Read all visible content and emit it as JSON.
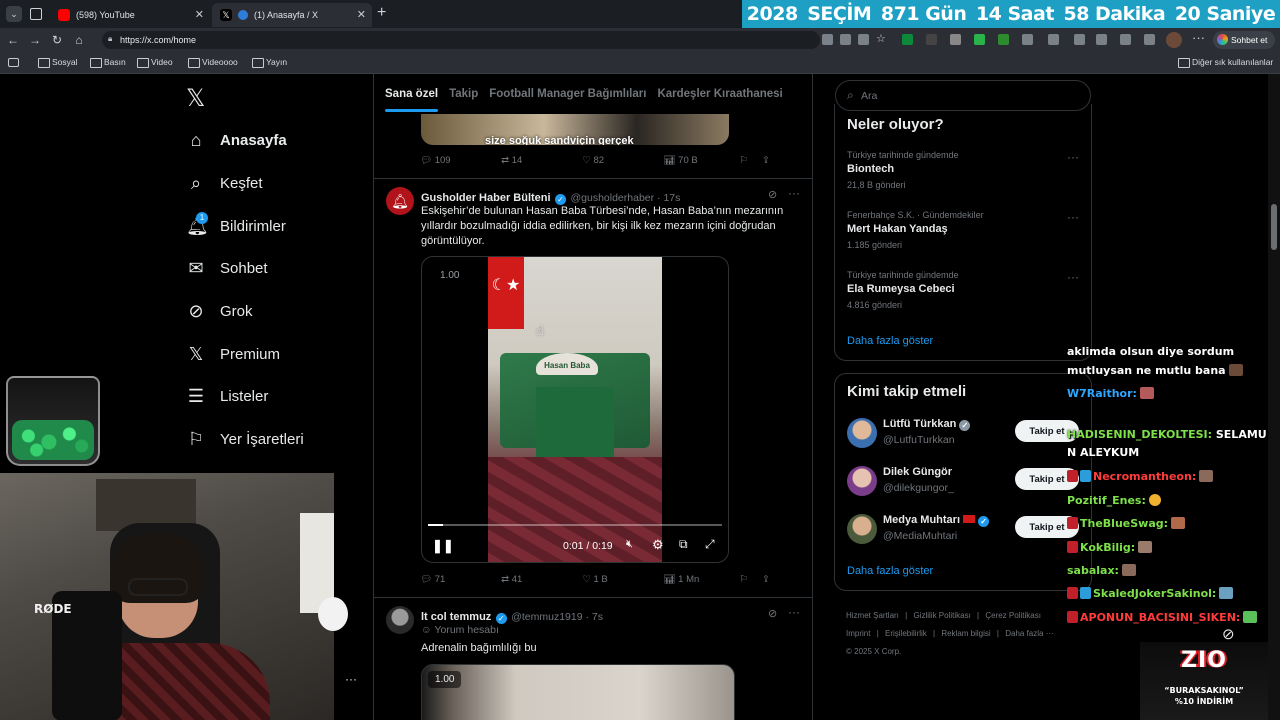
{
  "browser": {
    "tabs": [
      {
        "title": "(598) YouTube"
      },
      {
        "title": "(1) Anasayfa / X"
      }
    ],
    "url": "https://x.com/home",
    "chat_button": "Sohbet et",
    "bookmarks": [
      "Sosyal",
      "Basın",
      "Video",
      "Videoooo",
      "Yayın"
    ],
    "other_bookmarks": "Diğer sık kullanılanlar"
  },
  "countdown": {
    "year": "2028",
    "label": "SEÇİM",
    "days": "871 Gün",
    "hours": "14 Saat",
    "minutes": "58 Dakika",
    "seconds": "20 Saniye"
  },
  "sidebar": {
    "items": [
      {
        "label": "Anasayfa",
        "icon": "home-icon"
      },
      {
        "label": "Keşfet",
        "icon": "search-icon"
      },
      {
        "label": "Bildirimler",
        "icon": "bell-icon",
        "badge": "1"
      },
      {
        "label": "Sohbet",
        "icon": "mail-icon"
      },
      {
        "label": "Grok",
        "icon": "grok-icon"
      },
      {
        "label": "Premium",
        "icon": "x-icon"
      },
      {
        "label": "Listeler",
        "icon": "list-icon"
      },
      {
        "label": "Yer İşaretleri",
        "icon": "bookmark-icon"
      }
    ]
  },
  "feed": {
    "tabs": [
      "Sana özel",
      "Takip",
      "Football Manager Bağımlıları",
      "Kardeşler Kıraathanesi"
    ],
    "prev_tweet": {
      "caption": "size soğuk sandviçin gerçek",
      "replies": "109",
      "retweets": "14",
      "likes": "82",
      "views": "70 B"
    },
    "tweet1": {
      "name": "Gusholder Haber Bülteni",
      "handle": "@gusholderhaber · 17s",
      "text": "Eskişehir’de bulunan Hasan Baba Türbesi’nde, Hasan Baba’nın mezarının yıllardır bozulmadığı iddia edilirken, bir kişi ilk kez mezarın içini doğrudan görüntülüyor.",
      "video_speed": "1.00",
      "video_time": "0:01 / 0:19",
      "video_progress": 0.05,
      "sign_text": "Hasan Baba",
      "replies": "71",
      "retweets": "41",
      "likes": "1 B",
      "views": "1 Mn"
    },
    "tweet2": {
      "name": "lt col temmuz",
      "handle": "@temmuz1919 · 7s",
      "sub": "Yorum hesabı",
      "text": "Adrenalin bağımlılığı bu",
      "video_speed": "1.00"
    }
  },
  "right": {
    "search_placeholder": "Ara",
    "trends_title": "Neler oluyor?",
    "trends": [
      {
        "meta": "Türkiye tarihinde gündemde",
        "title": "Biontech",
        "count": "21,8 B gönderi"
      },
      {
        "meta": "Fenerbahçe S.K. · Gündemdekiler",
        "title": "Mert Hakan Yandaş",
        "count": "1.185 gönderi"
      },
      {
        "meta": "Türkiye tarihinde gündemde",
        "title": "Ela Rumeysa Cebeci",
        "count": "4.816 gönderi"
      }
    ],
    "show_more": "Daha fazla göster",
    "follow_title": "Kimi takip etmeli",
    "follow": [
      {
        "name": "Lütfü Türkkan",
        "handle": "@LutfuTurkkan",
        "button": "Takip et"
      },
      {
        "name": "Dilek Güngör",
        "handle": "@dilekgungor_",
        "button": "Takip et"
      },
      {
        "name": "Medya Muhtarı",
        "handle": "@MediaMuhtari",
        "button": "Takip et"
      }
    ],
    "show_more2": "Daha fazla göster",
    "footer1": [
      "Hizmet Şartları",
      "Gizlilik Politikası",
      "Çerez Politikası"
    ],
    "footer2": [
      "Imprint",
      "Erişilebilirlik",
      "Reklam bilgisi",
      "Daha fazla ···"
    ],
    "copyright": "© 2025 X Corp."
  },
  "chat": {
    "line0": "aklimda olsun diye sordum",
    "line0b": "mutluysan ne mutlu bana",
    "messages": [
      {
        "user": "W7Raithor:",
        "text": ""
      },
      {
        "user": "HADISENIN_DEKOLTESI:",
        "text": "SELAMU",
        "text2": "N ALEYKUM"
      },
      {
        "user": "Necromantheon:",
        "text": ""
      },
      {
        "user": "Pozitif_Enes:",
        "text": ""
      },
      {
        "user": "TheBlueSwag:",
        "text": ""
      },
      {
        "user": "KokBilig:",
        "text": ""
      },
      {
        "user": "sabalax:",
        "text": ""
      },
      {
        "user": "SkaledJokerSakinol:",
        "text": ""
      },
      {
        "user": "APONUN_BACISINI_SIKEN:",
        "text": ""
      }
    ]
  },
  "promo": {
    "logo": "ZIO",
    "line1": "“BURAKSAKINOL”",
    "line2": "%10 İNDİRİM"
  },
  "webcam": {
    "mic_brand": "RØDE"
  }
}
